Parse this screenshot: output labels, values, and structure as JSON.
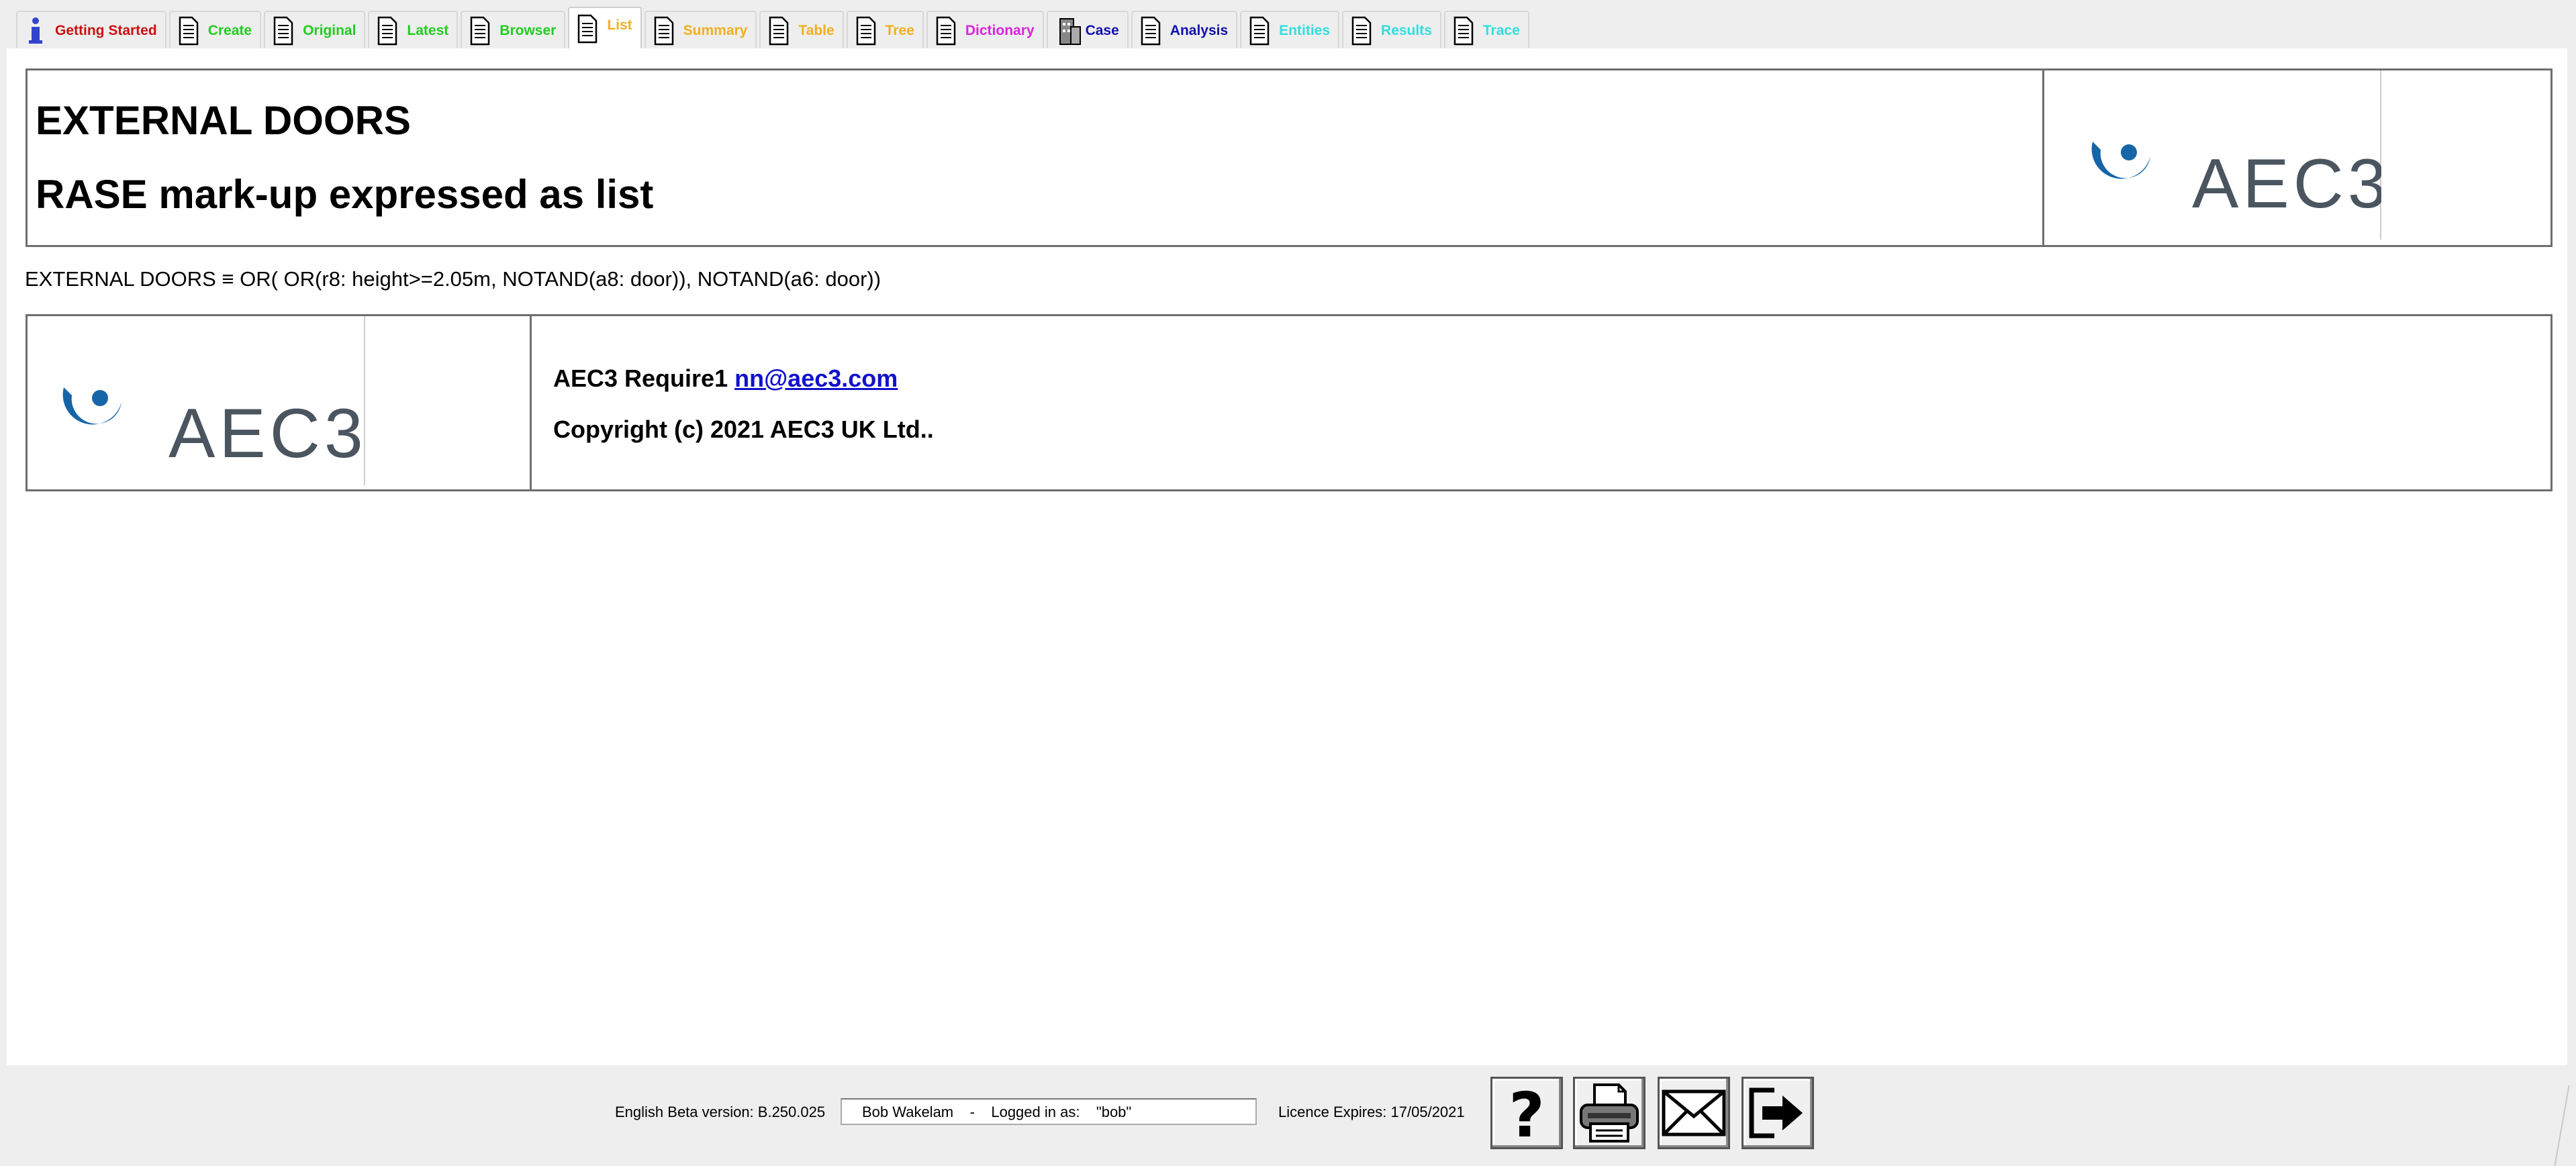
{
  "tabs": [
    {
      "label": "Getting Started",
      "color": "#cc1111",
      "icon": "info-icon"
    },
    {
      "label": "Create",
      "color": "#22cc22",
      "icon": "document-icon"
    },
    {
      "label": "Original",
      "color": "#22cc22",
      "icon": "document-icon"
    },
    {
      "label": "Latest",
      "color": "#22cc22",
      "icon": "document-icon"
    },
    {
      "label": "Browser",
      "color": "#22cc22",
      "icon": "document-icon"
    },
    {
      "label": "List",
      "color": "#f0b020",
      "icon": "document-icon",
      "active": true
    },
    {
      "label": "Summary",
      "color": "#f0b020",
      "icon": "document-icon"
    },
    {
      "label": "Table",
      "color": "#f0b020",
      "icon": "document-icon"
    },
    {
      "label": "Tree",
      "color": "#f0b020",
      "icon": "document-icon"
    },
    {
      "label": "Dictionary",
      "color": "#dd22dd",
      "icon": "document-icon"
    },
    {
      "label": "Case",
      "color": "#1111aa",
      "icon": "building-icon"
    },
    {
      "label": "Analysis",
      "color": "#1111aa",
      "icon": "document-icon"
    },
    {
      "label": "Entities",
      "color": "#33dddd",
      "icon": "document-icon"
    },
    {
      "label": "Results",
      "color": "#33dddd",
      "icon": "document-icon"
    },
    {
      "label": "Trace",
      "color": "#33dddd",
      "icon": "document-icon"
    }
  ],
  "header": {
    "title": "EXTERNAL DOORS",
    "subtitle": "RASE mark-up expressed as list",
    "logo_text": "AEC3"
  },
  "rule_expression": "EXTERNAL DOORS ≡ OR( OR(r8: height>=2.05m, NOTAND(a8: door)), NOTAND(a6: door))",
  "footer": {
    "require_text": "AEC3 Require1 ",
    "email": "nn@aec3.com",
    "copyright": "Copyright (c) 2021 AEC3 UK Ltd..",
    "logo_text": "AEC3"
  },
  "status": {
    "version": "English Beta version: B.250.025",
    "user_info": "Bob Wakelam    -    Logged in as:    \"bob\"",
    "licence": "Licence Expires: 17/05/2021"
  },
  "buttons": {
    "help_icon": "question-mark-icon",
    "print_icon": "printer-icon",
    "email_icon": "envelope-icon",
    "exit_icon": "exit-arrow-icon"
  },
  "colors": {
    "logo_blue": "#1565a8",
    "logo_text_gray": "#4a5560"
  }
}
